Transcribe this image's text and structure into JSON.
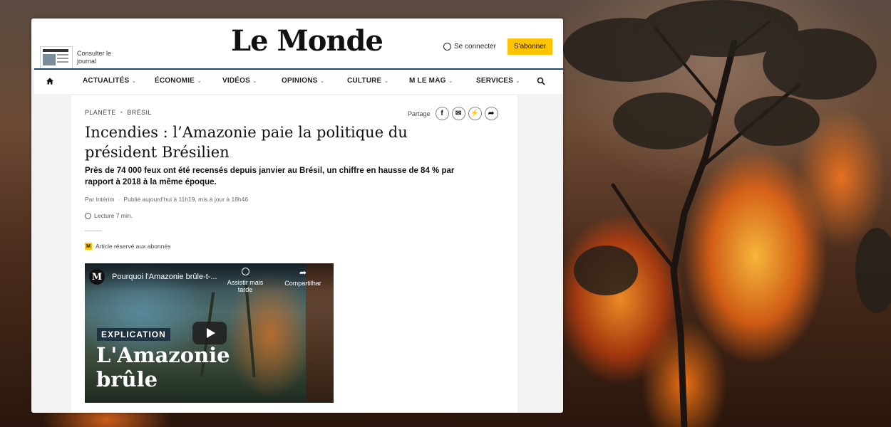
{
  "header": {
    "consult_label": "Consulter le journal",
    "logo": "Le Monde",
    "login_label": "Se connecter",
    "subscribe_label": "S'abonner"
  },
  "nav": {
    "items": [
      {
        "label": "Actualités"
      },
      {
        "label": "Économie"
      },
      {
        "label": "Vidéos"
      },
      {
        "label": "Opinions"
      },
      {
        "label": "Culture"
      },
      {
        "label": "M le mag"
      },
      {
        "label": "Services"
      }
    ]
  },
  "article": {
    "breadcrumb": [
      "Planète",
      "Brésil"
    ],
    "share_label": "Partage",
    "title": "Incendies : l’Amazonie paie la politique du président Brésilien",
    "lede": "Près de 74 000 feux ont été recensés depuis janvier au Brésil, un chiffre en hausse de 84 % par rapport à 2018 à la même époque.",
    "author": "Par Intérim",
    "published": "Publié aujourd’hui à 11h19, mis à jour à 18h46",
    "reading_time": "Lecture 7 min.",
    "reserved_badge": "M",
    "reserved_label": "Article réservé aux abonnés"
  },
  "video": {
    "channel_initial": "M",
    "title": "Pourquoi l'Amazonie brûle-t-...",
    "watch_later": "Assistir mais tarde",
    "share": "Compartilhar",
    "tag": "EXPLICATION",
    "headline": "L'Amazonie brûle"
  },
  "colors": {
    "accent_nav": "#1a4a72",
    "subscribe_bg": "#ffc400"
  }
}
